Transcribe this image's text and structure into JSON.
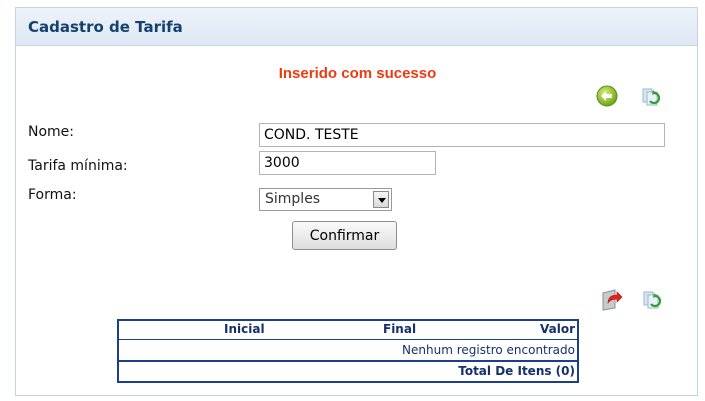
{
  "panel": {
    "title": "Cadastro de Tarifa"
  },
  "status": {
    "message": "Inserido com sucesso",
    "color": "#ec3a12"
  },
  "toolbar_top": {
    "icons": [
      "back-arrow-icon",
      "refresh-icon"
    ]
  },
  "form": {
    "nome": {
      "label": "Nome:",
      "value": "COND. TESTE"
    },
    "tarifa_minima": {
      "label": "Tarifa mínima:",
      "value": "3000"
    },
    "forma": {
      "label": "Forma:",
      "selected": "Simples"
    },
    "confirm_label": "Confirmar"
  },
  "toolbar_grid": {
    "icons": [
      "export-icon",
      "refresh-icon"
    ]
  },
  "grid": {
    "columns": [
      "Inicial",
      "Final",
      "Valor"
    ],
    "empty_message": "Nenhum registro encontrado",
    "total_label": "Total De Itens (0)"
  },
  "colors": {
    "title": "#15416c",
    "grid_border": "#1c3f8c",
    "header_bg": "#dde7f3"
  }
}
